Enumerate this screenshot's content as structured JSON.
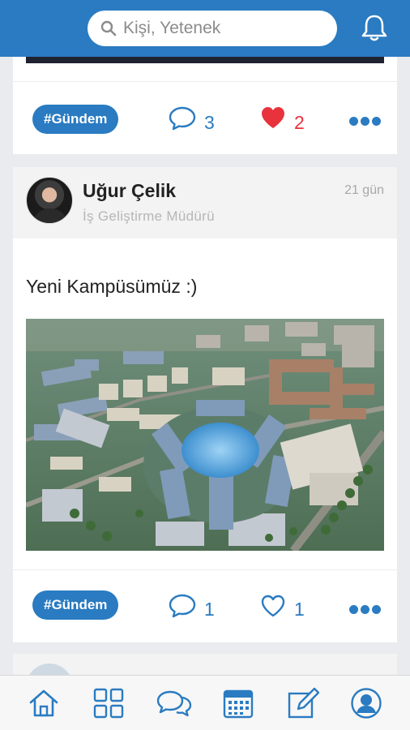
{
  "search": {
    "placeholder": "Kişi, Yetenek"
  },
  "feed": {
    "post1": {
      "tag": "#Gündem",
      "comments": "3",
      "likes": "2"
    },
    "post2": {
      "author": "Uğur Çelik",
      "role": "İş Geliştirme Müdürü",
      "time": "21 gün",
      "text": "Yeni Kampüsümüz :)",
      "tag": "#Gündem",
      "comments": "1",
      "likes": "1"
    }
  },
  "tabs": [
    "home-icon",
    "grid-icon",
    "chat-icon",
    "calendar-icon",
    "compose-icon",
    "profile-icon"
  ],
  "colors": {
    "brand": "#2a7bc1",
    "like_active": "#e8323c"
  }
}
